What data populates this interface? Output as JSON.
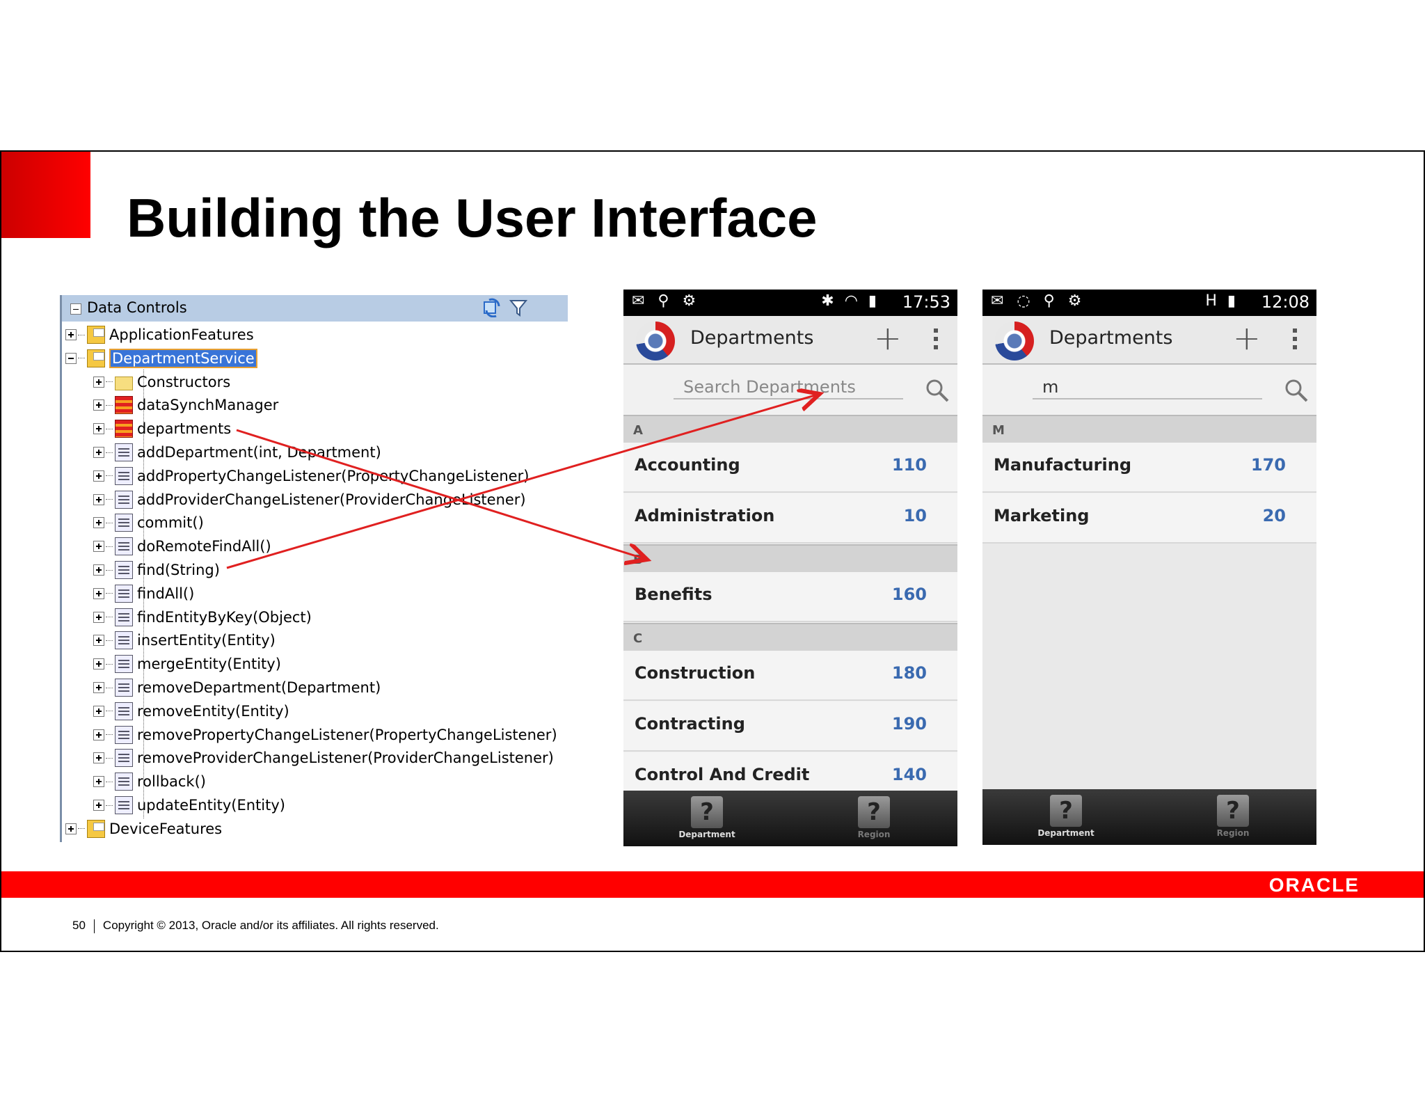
{
  "slide": {
    "title": "Building the User Interface",
    "page_number": "50",
    "copyright": "Copyright © 2013, Oracle and/or its affiliates. All rights reserved.",
    "brand": "ORACLE",
    "colors": {
      "accent": "#ff0000",
      "link_blue": "#3a6ab0"
    }
  },
  "data_controls": {
    "title": "Data Controls",
    "icons": [
      "refresh-icon",
      "filter-icon"
    ],
    "tree": [
      {
        "label": "ApplicationFeatures",
        "level": 0,
        "icon": "package-icon",
        "expanded": false
      },
      {
        "label": "DepartmentService",
        "level": 0,
        "icon": "package-icon",
        "expanded": true,
        "selected": true
      },
      {
        "label": "Constructors",
        "level": 1,
        "icon": "folder-icon"
      },
      {
        "label": "dataSynchManager",
        "level": 1,
        "icon": "collection-icon"
      },
      {
        "label": "departments",
        "level": 1,
        "icon": "collection-icon"
      },
      {
        "label": "addDepartment(int, Department)",
        "level": 1,
        "icon": "method-icon"
      },
      {
        "label": "addPropertyChangeListener(PropertyChangeListener)",
        "level": 1,
        "icon": "method-icon"
      },
      {
        "label": "addProviderChangeListener(ProviderChangeListener)",
        "level": 1,
        "icon": "method-icon"
      },
      {
        "label": "commit()",
        "level": 1,
        "icon": "method-icon"
      },
      {
        "label": "doRemoteFindAll()",
        "level": 1,
        "icon": "method-icon"
      },
      {
        "label": "find(String)",
        "level": 1,
        "icon": "method-icon"
      },
      {
        "label": "findAll()",
        "level": 1,
        "icon": "method-icon"
      },
      {
        "label": "findEntityByKey(Object)",
        "level": 1,
        "icon": "method-icon"
      },
      {
        "label": "insertEntity(Entity)",
        "level": 1,
        "icon": "method-icon"
      },
      {
        "label": "mergeEntity(Entity)",
        "level": 1,
        "icon": "method-icon"
      },
      {
        "label": "removeDepartment(Department)",
        "level": 1,
        "icon": "method-icon"
      },
      {
        "label": "removeEntity(Entity)",
        "level": 1,
        "icon": "method-icon"
      },
      {
        "label": "removePropertyChangeListener(PropertyChangeListener)",
        "level": 1,
        "icon": "method-icon"
      },
      {
        "label": "removeProviderChangeListener(ProviderChangeListener)",
        "level": 1,
        "icon": "method-icon"
      },
      {
        "label": "rollback()",
        "level": 1,
        "icon": "method-icon"
      },
      {
        "label": "updateEntity(Entity)",
        "level": 1,
        "icon": "method-icon"
      },
      {
        "label": "DeviceFeatures",
        "level": 0,
        "icon": "package-icon",
        "expanded": false
      }
    ]
  },
  "phone1": {
    "time": "17:53",
    "title": "Departments",
    "search": {
      "value": "",
      "placeholder": "Search Departments"
    },
    "sections": [
      {
        "letter": "A",
        "rows": [
          {
            "name": "Accounting",
            "id": "110"
          },
          {
            "name": "Administration",
            "id": "10"
          }
        ]
      },
      {
        "letter": "B",
        "rows": [
          {
            "name": "Benefits",
            "id": "160"
          }
        ]
      },
      {
        "letter": "C",
        "rows": [
          {
            "name": "Construction",
            "id": "180"
          },
          {
            "name": "Contracting",
            "id": "190"
          },
          {
            "name": "Control And Credit",
            "id": "140"
          }
        ]
      }
    ],
    "tabs": [
      {
        "label": "Department"
      },
      {
        "label": "Region"
      }
    ]
  },
  "phone2": {
    "time": "12:08",
    "title": "Departments",
    "search": {
      "value": "m",
      "placeholder": ""
    },
    "sections": [
      {
        "letter": "M",
        "rows": [
          {
            "name": "Manufacturing",
            "id": "170"
          },
          {
            "name": "Marketing",
            "id": "20"
          }
        ]
      }
    ],
    "tabs": [
      {
        "label": "Department"
      },
      {
        "label": "Region"
      }
    ]
  }
}
